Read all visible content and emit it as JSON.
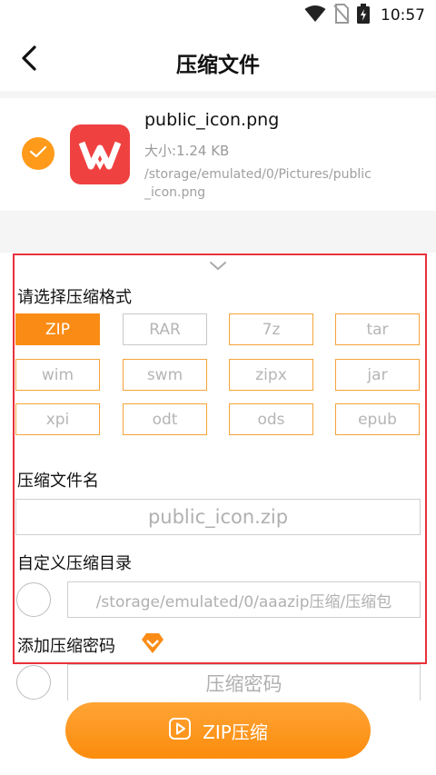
{
  "status": {
    "time": "10:57"
  },
  "header": {
    "title": "压缩文件"
  },
  "file": {
    "name": "public_icon.png",
    "size": "大小:1.24 KB",
    "path": "/storage/emulated/0/Pictures/public_icon.png"
  },
  "format_section": {
    "label": "请选择压缩格式",
    "formats": [
      "ZIP",
      "RAR",
      "7z",
      "tar",
      "wim",
      "swm",
      "zipx",
      "jar",
      "xpi",
      "odt",
      "ods",
      "epub"
    ],
    "selected": "ZIP"
  },
  "filename_section": {
    "label": "压缩文件名",
    "value": "public_icon.zip"
  },
  "directory_section": {
    "label": "自定义压缩目录",
    "placeholder": "/storage/emulated/0/aaazip压缩/压缩包"
  },
  "password_section": {
    "label": "添加压缩密码",
    "placeholder": "压缩密码"
  },
  "action": {
    "zip_button": "ZIP压缩"
  },
  "colors": {
    "accent": "#fa8c16",
    "highlight_frame": "#e8323c",
    "app_icon_bg": "#f04141"
  },
  "icons": [
    "wifi-icon",
    "no-sim-icon",
    "battery-charging-icon",
    "back-arrow-icon",
    "check-icon",
    "wps-app-icon",
    "chevron-down-icon",
    "vip-diamond-icon",
    "play-icon"
  ]
}
